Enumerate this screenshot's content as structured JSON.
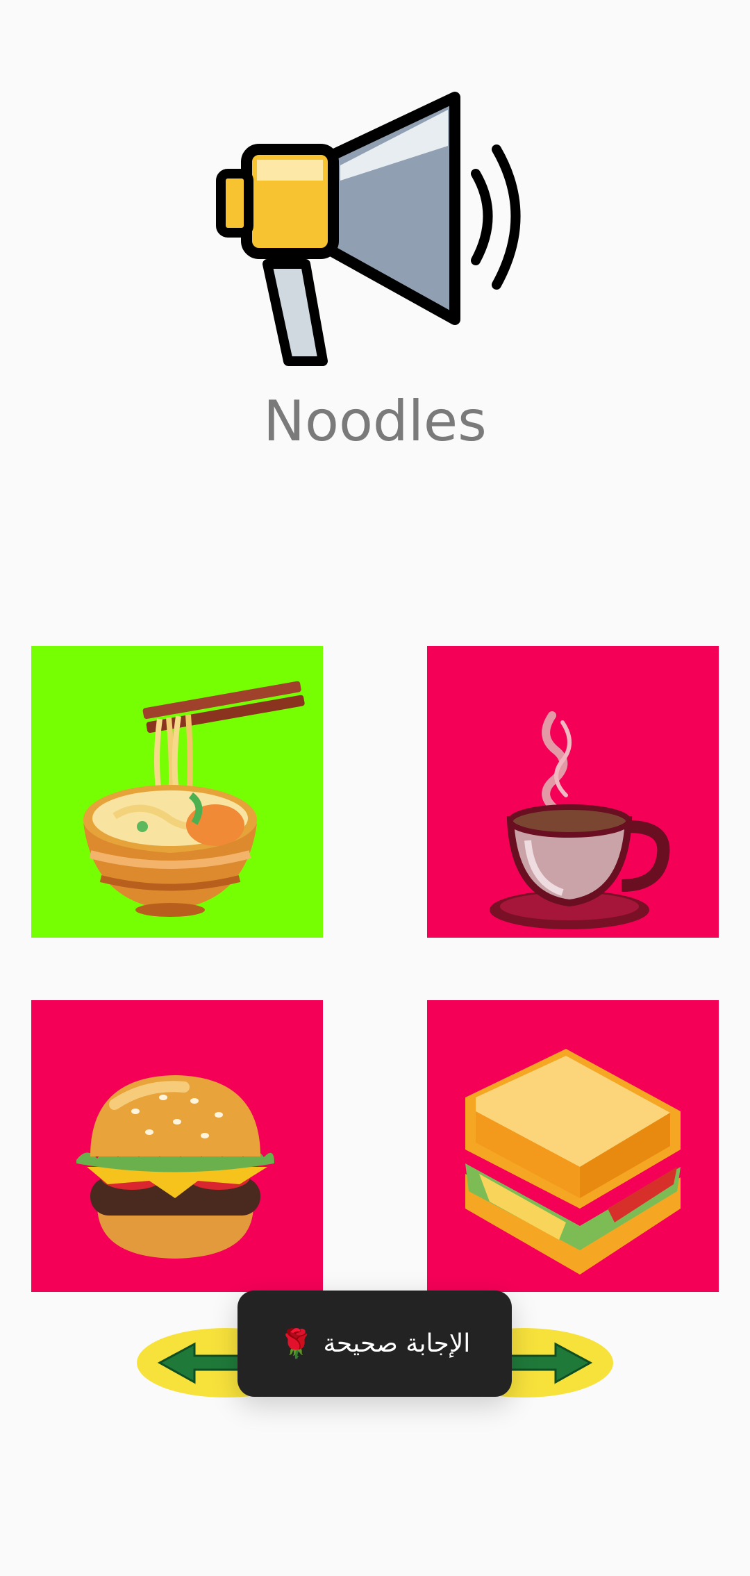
{
  "prompt": {
    "word": "Noodles",
    "speaker_icon": "megaphone-icon"
  },
  "options": [
    {
      "icon": "noodles-bowl-icon",
      "bg": "#76ff03"
    },
    {
      "icon": "coffee-cup-icon",
      "bg": "#f50057"
    },
    {
      "icon": "burger-icon",
      "bg": "#f50057"
    },
    {
      "icon": "sandwich-icon",
      "bg": "#f50057"
    }
  ],
  "navigation": {
    "prev_icon": "arrow-left-icon",
    "next_icon": "arrow-right-icon"
  },
  "toast": {
    "message": "الإجابة صحيحة",
    "emoji": "🌹"
  },
  "colors": {
    "background": "#fafafa",
    "correct": "#76ff03",
    "tile": "#f50057",
    "toast": "#232323"
  }
}
